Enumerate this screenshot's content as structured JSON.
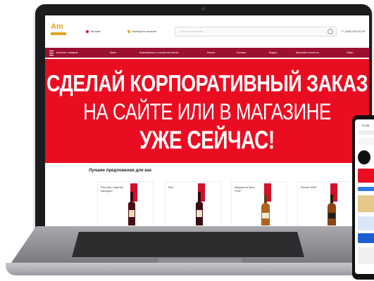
{
  "site": {
    "logo_text": "Am",
    "city": "Москва",
    "shops": "Выберите магазин",
    "search_placeholder": "Поиск по товарам",
    "phone": "+7 (495) 000-00-00"
  },
  "nav": {
    "items": [
      "Каталог товаров",
      "Вино",
      "Шампанское и игристые вина",
      "Виски",
      "Коньяк",
      "Водка",
      "Крепкий алкоголь",
      "Пиво"
    ]
  },
  "banner": {
    "line1": "СДЕЛАЙ КОРПОРАТИВНЫЙ ЗАКАЗ",
    "line2": "НА САЙТЕ ИЛИ В МАГАЗИНЕ",
    "line3": "УЖЕ СЕЙЧАС!"
  },
  "offers": {
    "title": "Лучшие предложения для вас",
    "products": [
      {
        "name": "Pinot Noir, Cabernet Sauvignon"
      },
      {
        "name": "Rolo"
      },
      {
        "name": "Marquise de Siruc VSOP"
      },
      {
        "name": "Pinouie VSOP"
      }
    ]
  },
  "phone_device": {
    "time": "21:36"
  },
  "colors": {
    "banner_red": "#ea0d22",
    "nav_maroon": "#9c1030",
    "logo_gold": "#e0a51f"
  }
}
